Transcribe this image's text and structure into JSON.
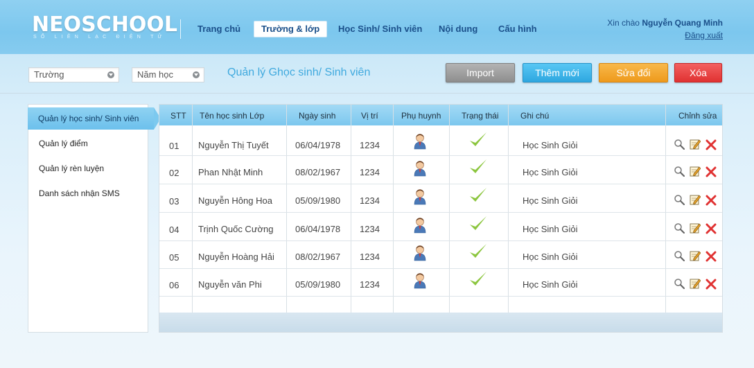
{
  "header": {
    "logo": "NEOSCHOOL",
    "logo_sub": "SỔ LIÊN LẠC ĐIỆN TỬ",
    "nav": [
      "Trang chủ",
      "Trường & lớp",
      "Học Sinh/ Sinh viên",
      "Nội dung",
      "Cấu hình"
    ],
    "active_nav": "Trường & lớp",
    "greeting_prefix": "Xin chào",
    "user_name": "Nguyễn Quang Minh",
    "logout": "Đăng xuất"
  },
  "toolbar": {
    "school_select": "Trường",
    "year_select": "Năm học",
    "page_heading": "Quản lý Ghọc sinh/ Sinh viên",
    "import_label": "Import",
    "add_label": "Thêm mới",
    "edit_label": "Sửa đổi",
    "delete_label": "Xóa"
  },
  "sidebar": {
    "items": [
      "Quản lý học sinh/ Sinh viên",
      "Quản lý điểm",
      "Quản lý rèn luyện",
      "Danh sách nhận SMS"
    ],
    "active": "Quản lý học sinh/ Sinh viên"
  },
  "table": {
    "headers": [
      "STT",
      "Tên học sinh  Lớp",
      "Ngày sinh",
      "Vị trí",
      "Phụ huynh",
      "Trạng thái",
      "Ghi chú",
      "Chỉnh sửa"
    ],
    "rows": [
      {
        "stt": "01",
        "name": "Nguyễn Thị Tuyết",
        "dob": "06/04/1978",
        "pos": "1234",
        "note": "Học Sinh Giỏi"
      },
      {
        "stt": "02",
        "name": "Phan Nhật Minh",
        "dob": "08/02/1967",
        "pos": "1234",
        "note": "Học Sinh Giỏi"
      },
      {
        "stt": "03",
        "name": "Nguyễn Hông Hoa",
        "dob": "05/09/1980",
        "pos": "1234",
        "note": "Học Sinh Giỏi"
      },
      {
        "stt": "04",
        "name": "Trịnh Quốc Cường",
        "dob": "06/04/1978",
        "pos": "1234",
        "note": "Học Sinh Giỏi"
      },
      {
        "stt": "05",
        "name": "Nguyễn Hoàng Hải",
        "dob": "08/02/1967",
        "pos": "1234",
        "note": "Học Sinh Giỏi"
      },
      {
        "stt": "06",
        "name": "Nguyễn văn Phi",
        "dob": "05/09/1980",
        "pos": "1234",
        "note": "Học Sinh Giỏi"
      }
    ]
  },
  "colors": {
    "accent": "#3fa9de",
    "check": "#8cc63f",
    "delete": "#e03232"
  }
}
